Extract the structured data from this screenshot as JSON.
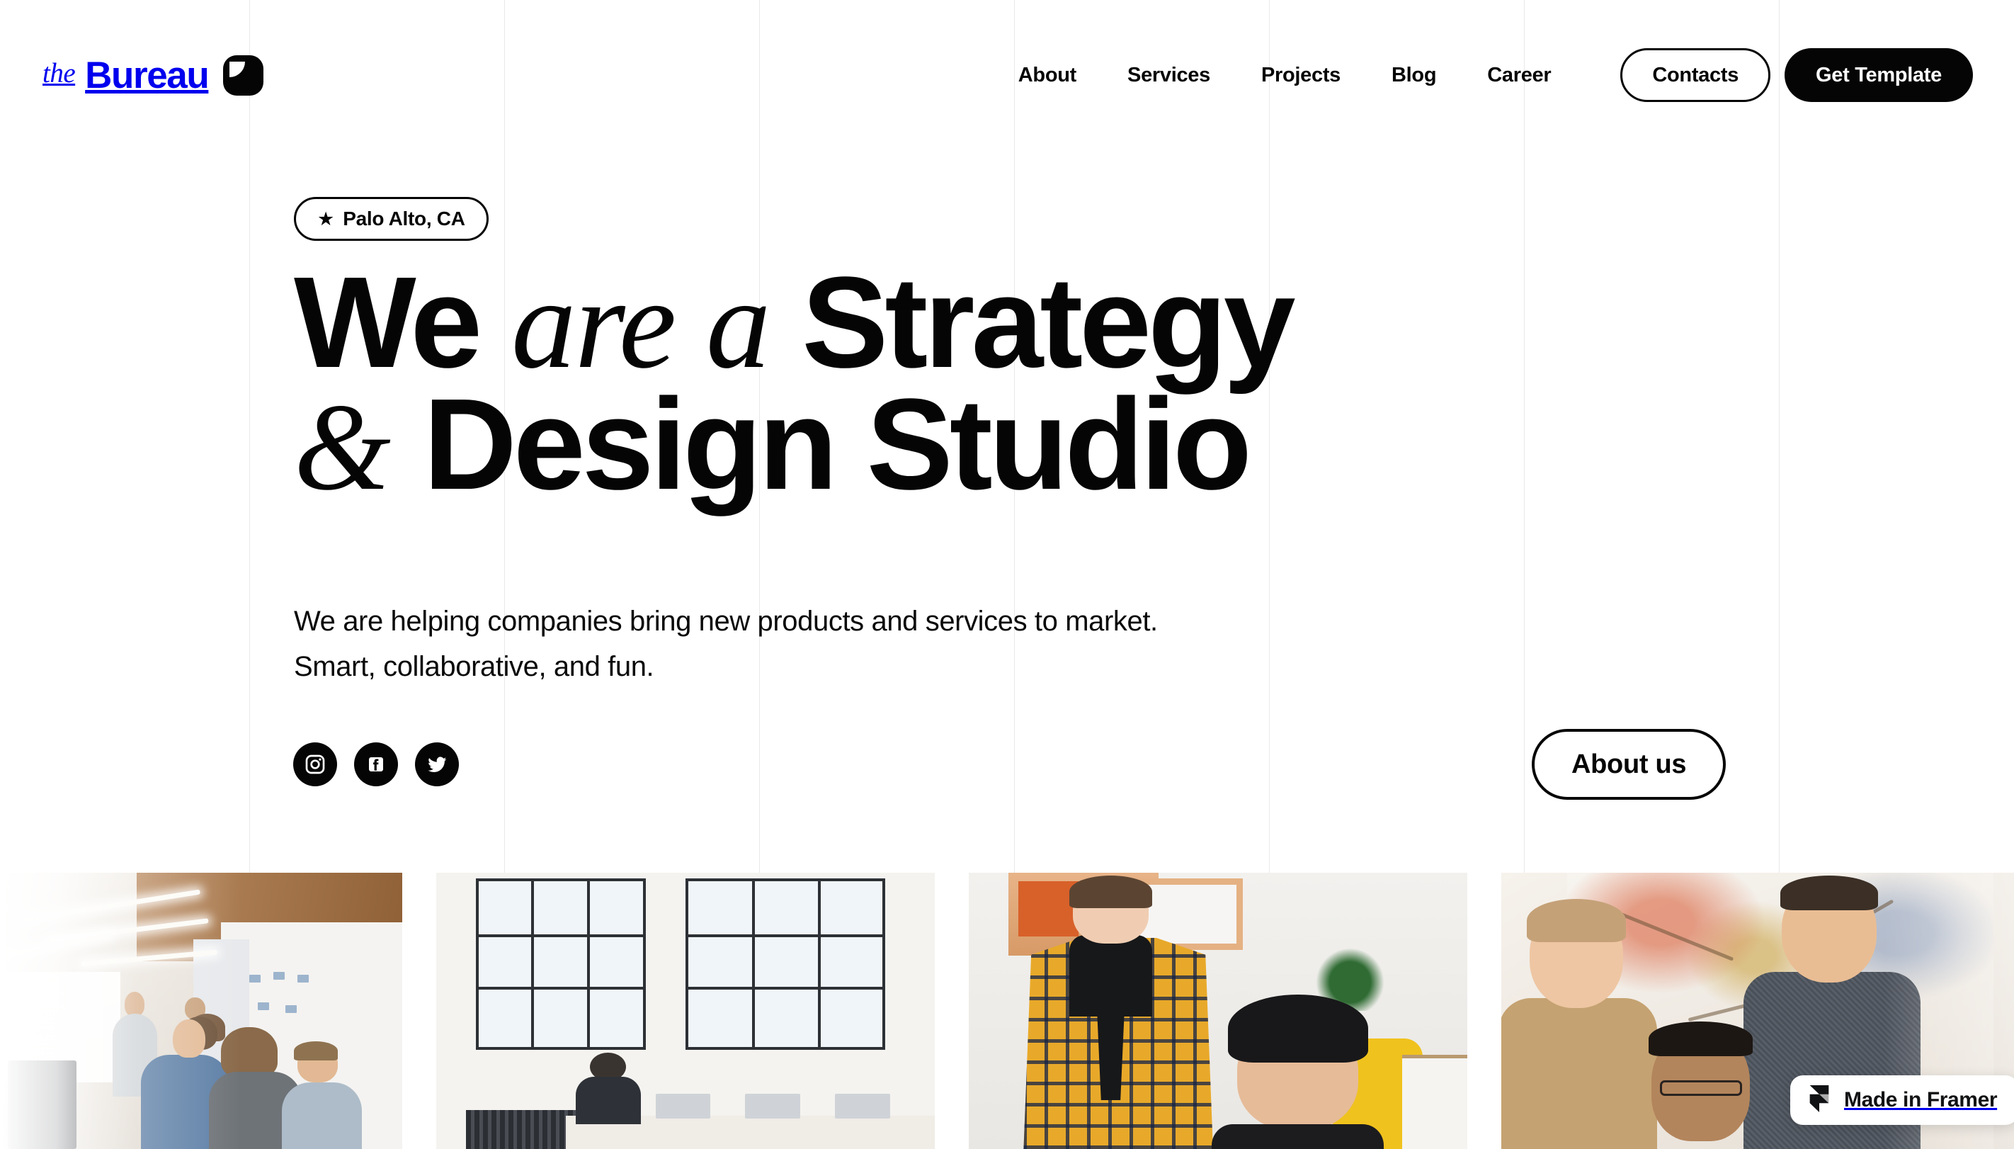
{
  "site": {
    "brand_prefix": "the",
    "brand_name": "Bureau",
    "logo_mark": "rounded-square-notch"
  },
  "header": {
    "nav": [
      {
        "label": "About"
      },
      {
        "label": "Services"
      },
      {
        "label": "Projects"
      },
      {
        "label": "Blog"
      },
      {
        "label": "Career"
      }
    ],
    "contacts_label": "Contacts",
    "cta_label": "Get Template"
  },
  "hero": {
    "badge_star": "★",
    "badge_label": "Palo Alto, CA",
    "headline_line1_a": "We ",
    "headline_line1_b": "are a",
    "headline_line1_c": " Strategy",
    "headline_line2_amp": "&",
    "headline_line2_b": " Design Studio",
    "subtitle_line1": "We are helping companies bring new products and services to market.",
    "subtitle_line2": "Smart, collaborative, and fun.",
    "about_label": "About us",
    "socials": [
      {
        "name": "instagram"
      },
      {
        "name": "facebook"
      },
      {
        "name": "twitter"
      }
    ]
  },
  "gallery": {
    "items": [
      {
        "alt": "open office with team collaborating at whiteboard"
      },
      {
        "alt": "studio with large black framed windows and person at desk"
      },
      {
        "alt": "woman in yellow plaid coat and man in black beanie"
      },
      {
        "alt": "three men smiling in front of large artwork"
      }
    ]
  },
  "framer": {
    "label": "Made in Framer"
  },
  "colors": {
    "ink": "#050505",
    "paper": "#ffffff",
    "guide": "#e9e9e9"
  }
}
